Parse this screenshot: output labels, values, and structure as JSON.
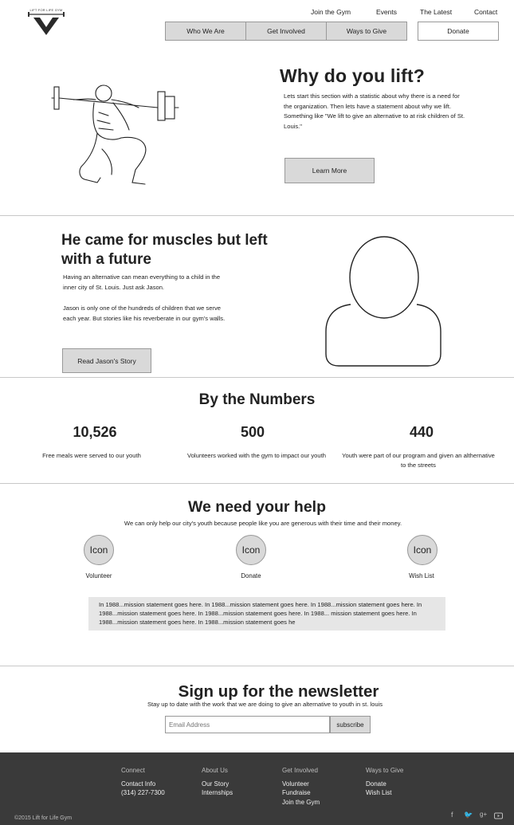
{
  "header": {
    "logo_text": "LIFT FOR LIFE GYM",
    "top_links": [
      "Join the Gym",
      "Events",
      "The Latest",
      "Contact"
    ],
    "sub_nav": [
      "Who We Are",
      "Get Involved",
      "Ways to Give"
    ],
    "donate_label": "Donate"
  },
  "hero": {
    "title": "Why do you lift?",
    "text": "Lets start this section with a statistic about why there is a need for the organization. Then lets have a statement about why we lift.  Something like \"We lift to give an alternative to at risk children of St. Louis.\"",
    "button_label": "Learn More"
  },
  "story": {
    "title": "He came for muscles but left with a future",
    "paragraph1": "Having an alternative can mean everything to a child in the inner city of St. Louis.  Just ask Jason.",
    "paragraph2": "Jason is only one of the hundreds of children that we serve each year.  But stories like his reverberate in our gym's walls.",
    "button_label": "Read Jason's Story"
  },
  "numbers": {
    "title": "By the Numbers",
    "stats": [
      {
        "value": "10,526",
        "label": "Free meals were served to our youth"
      },
      {
        "value": "500",
        "label": "Volunteers worked with the gym to impact our youth"
      },
      {
        "value": "440",
        "label": "Youth were part of our program and given an althernative to the streets"
      }
    ]
  },
  "help": {
    "title": "We need your help",
    "subtitle": "We can only help our city's youth because people like you are generous with their time and their money.",
    "items": [
      {
        "icon": "Icon",
        "label": "Volunteer"
      },
      {
        "icon": "Icon",
        "label": "Donate"
      },
      {
        "icon": "Icon",
        "label": "Wish List"
      }
    ],
    "mission": "In 1988...mission statement goes here.  In 1988...mission statement goes here.  In 1988...mission statement goes here.  In 1988...mission statement goes here.  In 1988...mission statement goes here.  In 1988... mission statement goes here.  In 1988...mission statement goes here.  In 1988...mission statement goes he"
  },
  "newsletter": {
    "title": "Sign up for the newsletter",
    "subtitle": "Stay up to date with the work that we are doing to give an alternative to youth in st. louis",
    "email_placeholder": "Email Address",
    "subscribe_label": "subscribe"
  },
  "footer": {
    "columns": [
      {
        "heading": "Connect",
        "links": [
          "Contact Info",
          "(314) 227-7300"
        ]
      },
      {
        "heading": "About Us",
        "links": [
          "Our Story",
          "Internships"
        ]
      },
      {
        "heading": "Get Involved",
        "links": [
          "Volunteer",
          "Fundraise",
          "Join the Gym"
        ]
      },
      {
        "heading": "Ways to Give",
        "links": [
          "Donate",
          "Wish List"
        ]
      }
    ],
    "copyright": "©2015 Lift for Life Gym",
    "social_icons": [
      "facebook-icon",
      "twitter-icon",
      "google-plus-icon",
      "youtube-icon"
    ]
  }
}
